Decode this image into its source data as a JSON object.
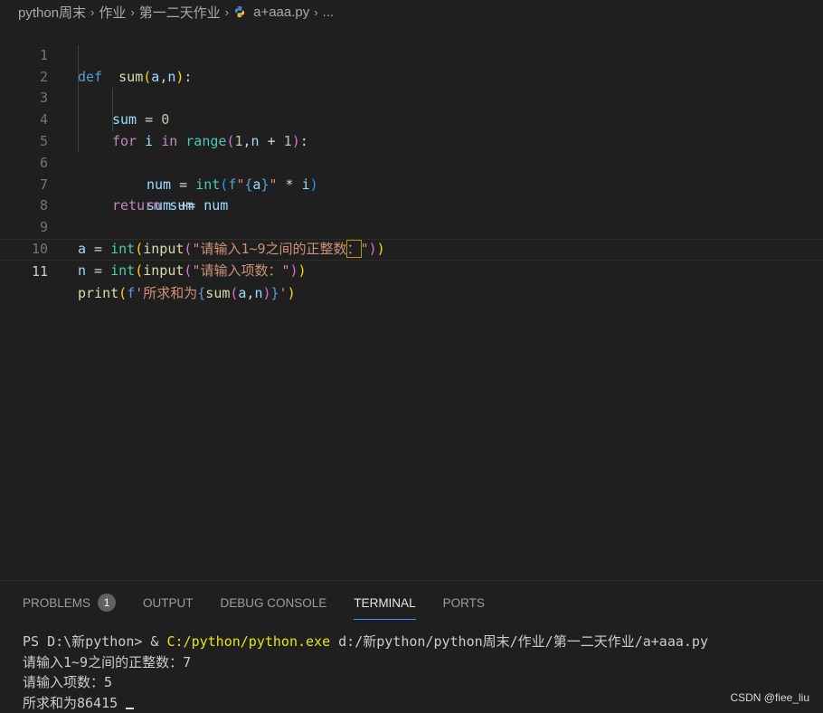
{
  "breadcrumb": {
    "items": [
      "python周末",
      "作业",
      "第一二天作业"
    ],
    "file": "a+aaa.py",
    "ellipsis": "...",
    "separator": "›"
  },
  "editor": {
    "line_numbers": [
      "1",
      "2",
      "3",
      "4",
      "5",
      "6",
      "7",
      "8",
      "9",
      "10",
      "11"
    ],
    "code": {
      "l1": {
        "def": "def",
        "name": "sum",
        "p_open": "(",
        "a": "a",
        "comma": ",",
        "n": "n",
        "p_close": ")",
        "colon": ":"
      },
      "l2": {
        "var": "sum",
        "eq": " = ",
        "val": "0"
      },
      "l3": {
        "for": "for",
        "i": "i",
        "in": "in",
        "range": "range",
        "p_open": "(",
        "one": "1",
        "comma": ",",
        "n": "n",
        "plus": " + ",
        "one2": "1",
        "p_close": ")",
        "colon": ":"
      },
      "l4": {
        "num": "num",
        "eq": " = ",
        "int": "int",
        "p_open": "(",
        "f": "f",
        "q1": "\"",
        "b_open": "{",
        "a": "a",
        "b_close": "}",
        "q2": "\"",
        "mul": " * ",
        "i": "i",
        "p_close": ")"
      },
      "l5": {
        "sum": "sum",
        "op": " += ",
        "num": "num"
      },
      "l6": {
        "ret": "return",
        "sum": "sum"
      },
      "l9": {
        "a": "a",
        "eq": " = ",
        "int": "int",
        "p1": "(",
        "input": "input",
        "p2": "(",
        "str1": "\"请输入1~9之间的正整数",
        "colon": "：",
        "q": "\"",
        "p3": ")",
        "p4": ")"
      },
      "l10": {
        "n": "n",
        "eq": " = ",
        "int": "int",
        "p1": "(",
        "input": "input",
        "p2": "(",
        "str": "\"请输入项数：\"",
        "p3": ")",
        "p4": ")"
      },
      "l11": {
        "print": "print",
        "p1": "(",
        "f": "f",
        "q1": "'",
        "text": "所求和为",
        "b_open": "{",
        "sum": "sum",
        "p2": "(",
        "a": "a",
        "comma": ",",
        "n": "n",
        "p3": ")",
        "b_close": "}",
        "q2": "'",
        "p4": ")"
      }
    }
  },
  "panel": {
    "tabs": [
      {
        "label": "PROBLEMS",
        "badge": "1"
      },
      {
        "label": "OUTPUT"
      },
      {
        "label": "DEBUG CONSOLE"
      },
      {
        "label": "TERMINAL",
        "active": true
      },
      {
        "label": "PORTS"
      }
    ],
    "terminal": {
      "prompt": "PS D:\\新python> & ",
      "exe": "C:/python/python.exe",
      "script": " d:/新python/python周末/作业/第一二天作业/a+aaa.py",
      "out1": "请输入1~9之间的正整数：7",
      "out2": "请输入项数：5",
      "out3": "所求和为86415"
    }
  },
  "watermark": "CSDN @fiee_liu",
  "colors": {
    "background": "#1f1f1f",
    "active_tab_border": "#3794ff",
    "keyword": "#569cd6",
    "string": "#ce9178"
  }
}
